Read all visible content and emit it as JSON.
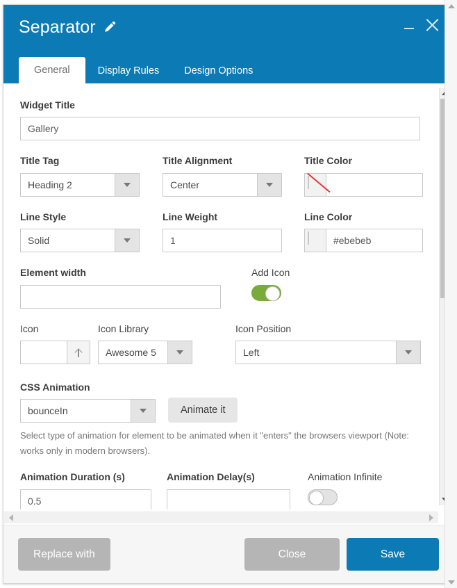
{
  "window": {
    "title": "Separator",
    "edit_icon": "pencil-icon",
    "minimize_icon": "minimize-icon",
    "close_icon": "close-icon",
    "accent_color": "#0c7ab5"
  },
  "tabs": [
    {
      "label": "General",
      "active": true
    },
    {
      "label": "Display Rules",
      "active": false
    },
    {
      "label": "Design Options",
      "active": false
    }
  ],
  "form": {
    "widget_title": {
      "label": "Widget Title",
      "value": "Gallery",
      "placeholder": ""
    },
    "title_tag": {
      "label": "Title Tag",
      "value": "Heading 2"
    },
    "title_alignment": {
      "label": "Title Alignment",
      "value": "Center"
    },
    "title_color": {
      "label": "Title Color",
      "value": "",
      "placeholder": "",
      "swatch": "none",
      "swatch_color": "#ffffff"
    },
    "line_style": {
      "label": "Line Style",
      "value": "Solid"
    },
    "line_weight": {
      "label": "Line Weight",
      "value": "1",
      "placeholder": ""
    },
    "line_color": {
      "label": "Line Color",
      "value": "#ebebeb",
      "swatch_color": "#ebebeb"
    },
    "element_width": {
      "label": "Element width",
      "value": "",
      "placeholder": ""
    },
    "add_icon": {
      "label": "Add Icon",
      "state": "on"
    },
    "icon": {
      "label": "Icon",
      "value": "",
      "placeholder": "",
      "button_icon": "arrow-up-icon"
    },
    "icon_library": {
      "label": "Icon Library",
      "value": "Awesome 5"
    },
    "icon_position": {
      "label": "Icon Position",
      "value": "Left"
    },
    "css_animation": {
      "label": "CSS Animation",
      "value": "bounceIn",
      "animate_button": "Animate it",
      "help": "Select type of animation for element to be animated when it \"enters\" the browsers viewport (Note: works only in modern browsers)."
    },
    "animation_duration": {
      "label": "Animation Duration (s)",
      "value": "0.5",
      "placeholder": ""
    },
    "animation_delay": {
      "label": "Animation Delay(s)",
      "value": "",
      "placeholder": ""
    },
    "animation_infinite": {
      "label": "Animation Infinite",
      "state": "off"
    }
  },
  "footer": {
    "replace_with": "Replace with",
    "close": "Close",
    "save": "Save"
  }
}
